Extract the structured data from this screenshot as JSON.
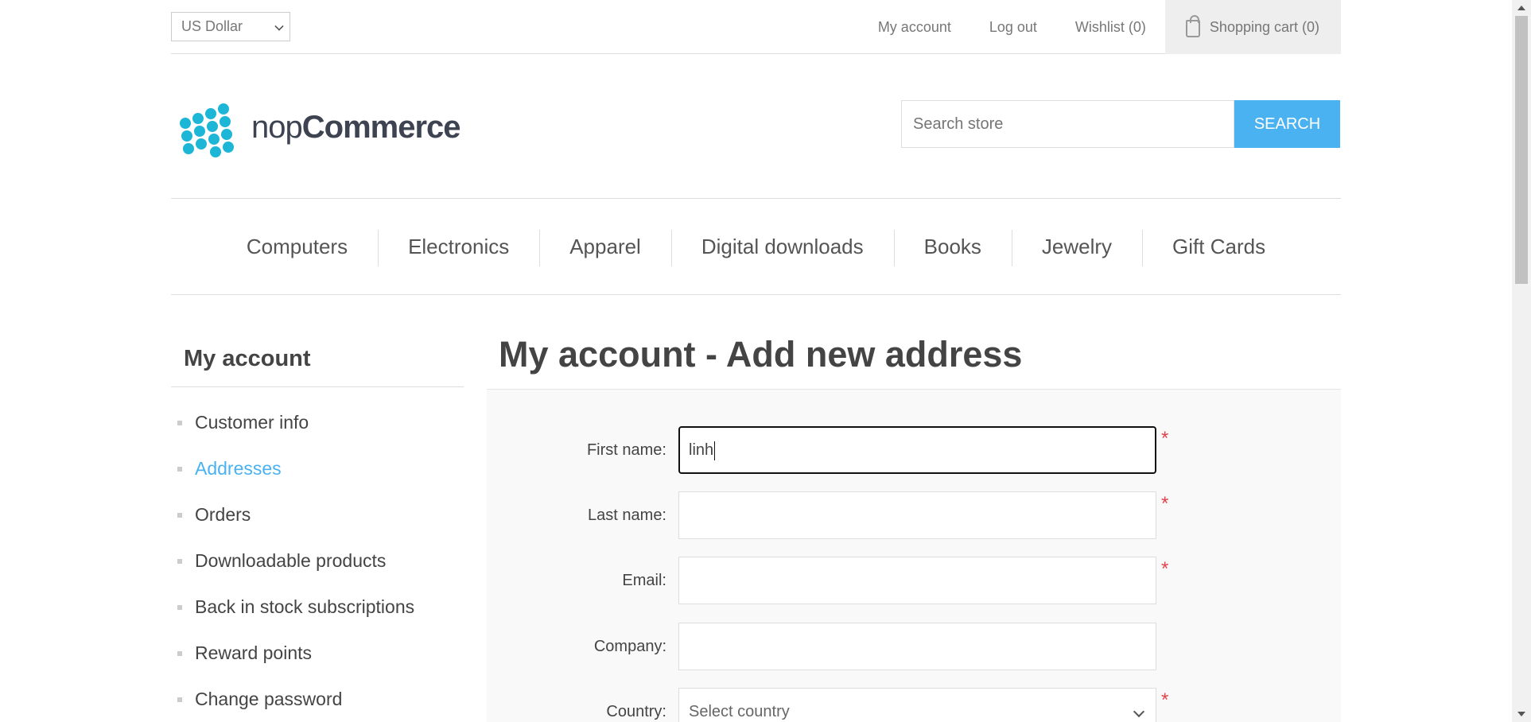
{
  "header": {
    "currency": "US Dollar",
    "links": {
      "my_account": "My account",
      "log_out": "Log out",
      "wishlist": "Wishlist (0)",
      "cart": "Shopping cart (0)"
    }
  },
  "logo": {
    "text_light": "nop",
    "text_bold": "Commerce",
    "color": "#1eb6d6"
  },
  "search": {
    "placeholder": "Search store",
    "button": "SEARCH",
    "accent": "#4ab2f1"
  },
  "nav": [
    "Computers",
    "Electronics",
    "Apparel",
    "Digital downloads",
    "Books",
    "Jewelry",
    "Gift Cards"
  ],
  "sidebar": {
    "title": "My account",
    "items": [
      {
        "label": "Customer info",
        "active": false
      },
      {
        "label": "Addresses",
        "active": true
      },
      {
        "label": "Orders",
        "active": false
      },
      {
        "label": "Downloadable products",
        "active": false
      },
      {
        "label": "Back in stock subscriptions",
        "active": false
      },
      {
        "label": "Reward points",
        "active": false
      },
      {
        "label": "Change password",
        "active": false
      }
    ]
  },
  "main": {
    "title": "My account - Add new address",
    "form": {
      "first_name": {
        "label": "First name:",
        "value": "linh",
        "required": true
      },
      "last_name": {
        "label": "Last name:",
        "value": "",
        "required": true
      },
      "email": {
        "label": "Email:",
        "value": "",
        "required": true
      },
      "company": {
        "label": "Company:",
        "value": "",
        "required": false
      },
      "country": {
        "label": "Country:",
        "value": "Select country",
        "required": true
      }
    },
    "required_mark": "*"
  }
}
